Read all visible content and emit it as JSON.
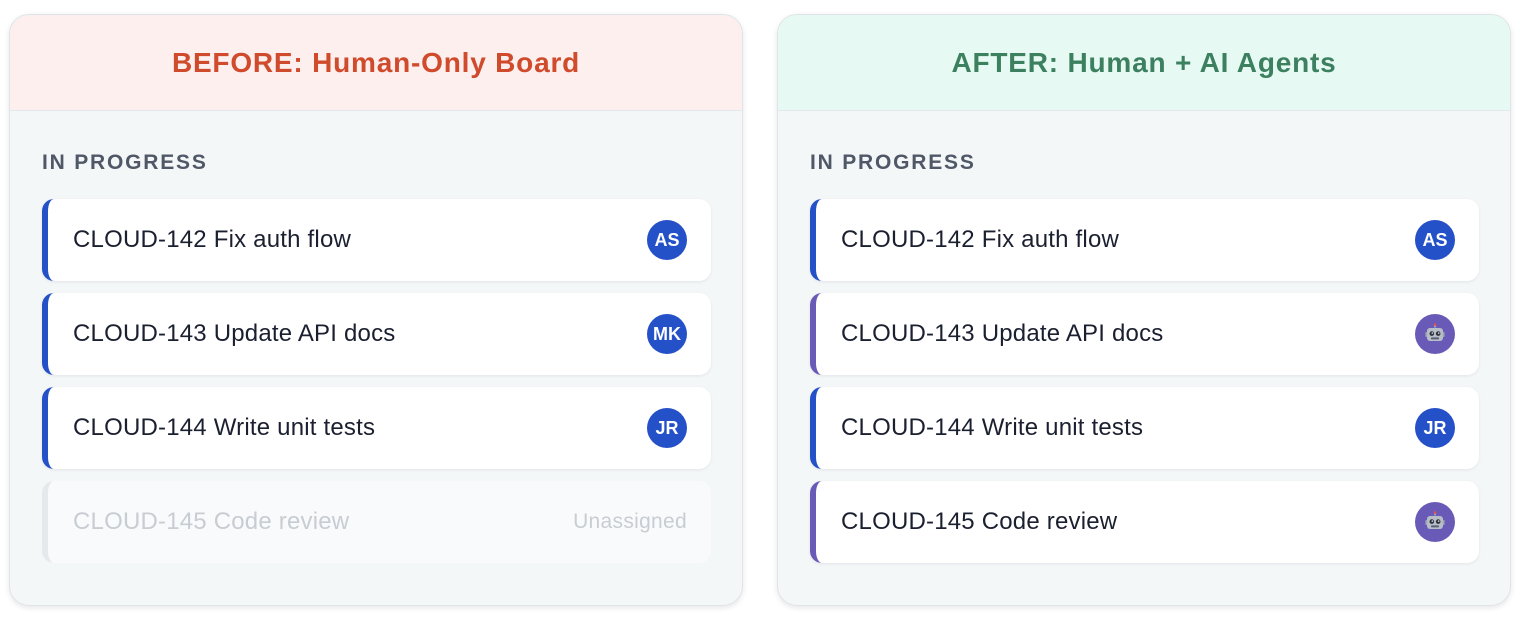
{
  "before": {
    "title": "BEFORE: Human-Only Board",
    "column_label": "IN PROGRESS",
    "cards": [
      {
        "title": "CLOUD-142 Fix auth flow",
        "assignee": "AS"
      },
      {
        "title": "CLOUD-143 Update API docs",
        "assignee": "MK"
      },
      {
        "title": "CLOUD-144 Write unit tests",
        "assignee": "JR"
      },
      {
        "title": "CLOUD-145 Code review",
        "status": "Unassigned"
      }
    ]
  },
  "after": {
    "title": "AFTER: Human + AI Agents",
    "column_label": "IN PROGRESS",
    "cards": [
      {
        "title": "CLOUD-142 Fix auth flow",
        "assignee": "AS"
      },
      {
        "title": "CLOUD-143 Update API docs",
        "assignee_icon": "robot-icon"
      },
      {
        "title": "CLOUD-144 Write unit tests",
        "assignee": "JR"
      },
      {
        "title": "CLOUD-145 Code review",
        "assignee_icon": "robot-icon"
      }
    ]
  },
  "colors": {
    "before_header_bg": "#fcefee",
    "before_title": "#d04a2c",
    "after_header_bg": "#e6faf3",
    "after_title": "#3c8060",
    "human_accent": "#2450c8",
    "agent_accent": "#6a5ab8"
  }
}
